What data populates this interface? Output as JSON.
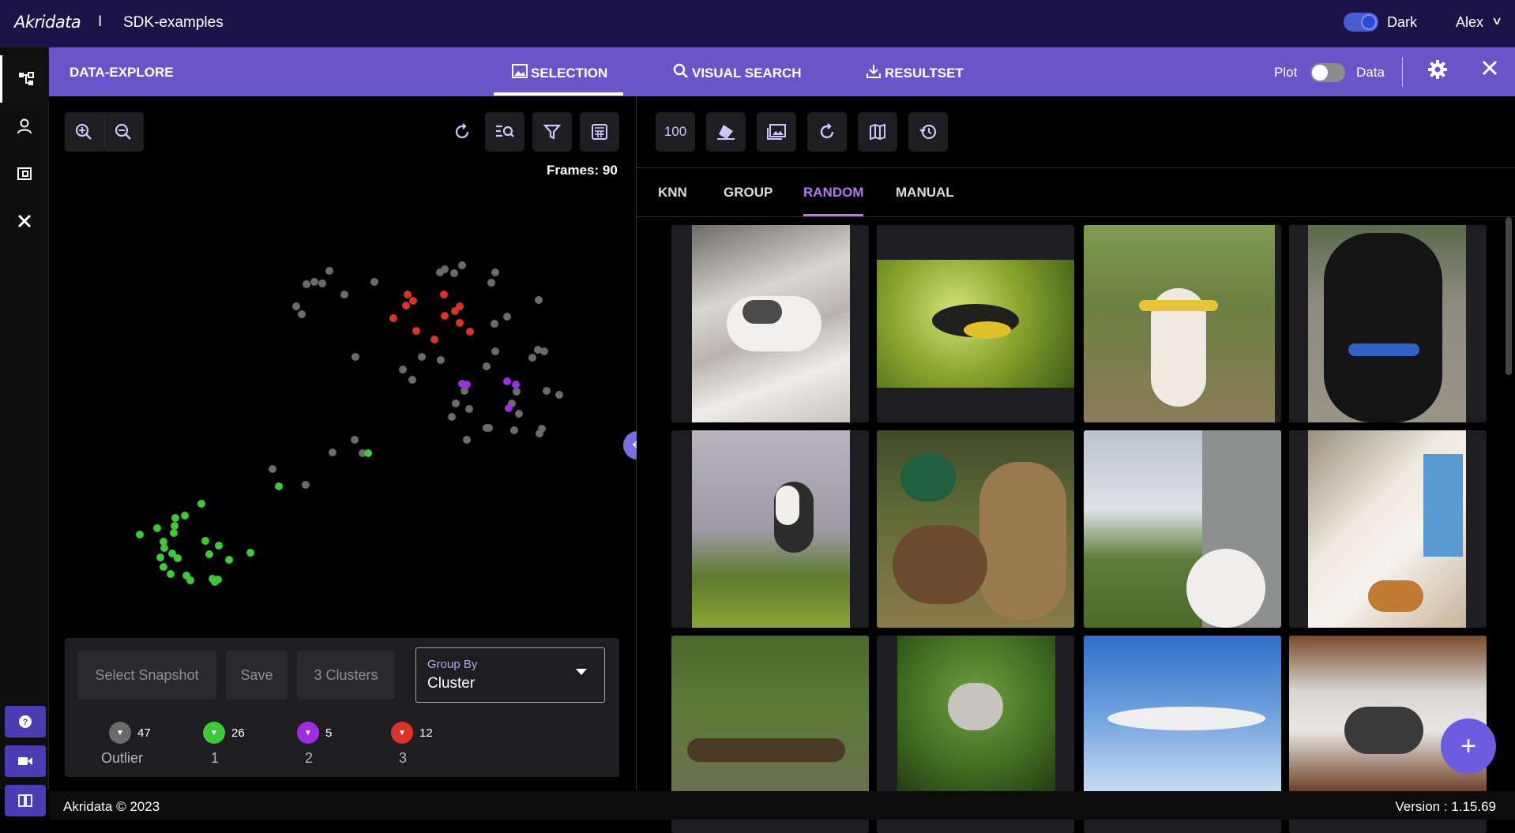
{
  "topbar": {
    "logo": "Akridata",
    "separator": "I",
    "project": "SDK-examples",
    "theme_label": "Dark",
    "user": "Alex"
  },
  "subbar": {
    "title": "DATA-EXPLORE",
    "tabs": [
      {
        "label": "SELECTION",
        "icon": "image-icon",
        "active": true
      },
      {
        "label": "VISUAL SEARCH",
        "icon": "search-icon",
        "active": false
      },
      {
        "label": "RESULTSET",
        "icon": "download-icon",
        "active": false
      }
    ],
    "plot_label": "Plot",
    "data_label": "Data"
  },
  "left": {
    "frames_label": "Frames: 90",
    "buttons": {
      "snapshot": "Select Snapshot",
      "save": "Save",
      "clusters": "3 Clusters"
    },
    "group_by": {
      "label": "Group By",
      "value": "Cluster"
    },
    "legend": [
      {
        "count": "47",
        "name": "Outlier",
        "color": "#6b6b6b"
      },
      {
        "count": "26",
        "name": "1",
        "color": "#3fc83a"
      },
      {
        "count": "5",
        "name": "2",
        "color": "#9b2fe0"
      },
      {
        "count": "12",
        "name": "3",
        "color": "#d8342a"
      }
    ]
  },
  "right": {
    "count_button": "100",
    "tabs": [
      "KNN",
      "GROUP",
      "RANDOM",
      "MANUAL"
    ],
    "active_tab": "RANDOM"
  },
  "footer": {
    "copyright": "Akridata © 2023",
    "version": "Version : 1.15.69"
  },
  "colors": {
    "topbar": "#1c1448",
    "subbar": "#6a55c8",
    "accent": "#b17bf0",
    "fab": "#6d5ce0"
  }
}
